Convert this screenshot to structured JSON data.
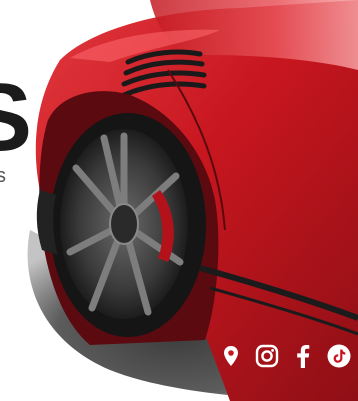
{
  "hero": {
    "headline_fragment": "S",
    "subline_fragment": "s"
  },
  "social_icons": [
    {
      "name": "location-pin",
      "label": ""
    },
    {
      "name": "instagram",
      "label": ""
    },
    {
      "name": "facebook",
      "label": ""
    },
    {
      "name": "tiktok",
      "label": ""
    }
  ],
  "colors": {
    "car_body": "#d01f28",
    "car_shadow": "#7a0c12",
    "wheel": "#3b3b3b",
    "brake_caliper": "#b3121b",
    "ground_shadow": "#2e2e2e",
    "icon": "#ffffff",
    "text_dark": "#1b1b1b"
  }
}
